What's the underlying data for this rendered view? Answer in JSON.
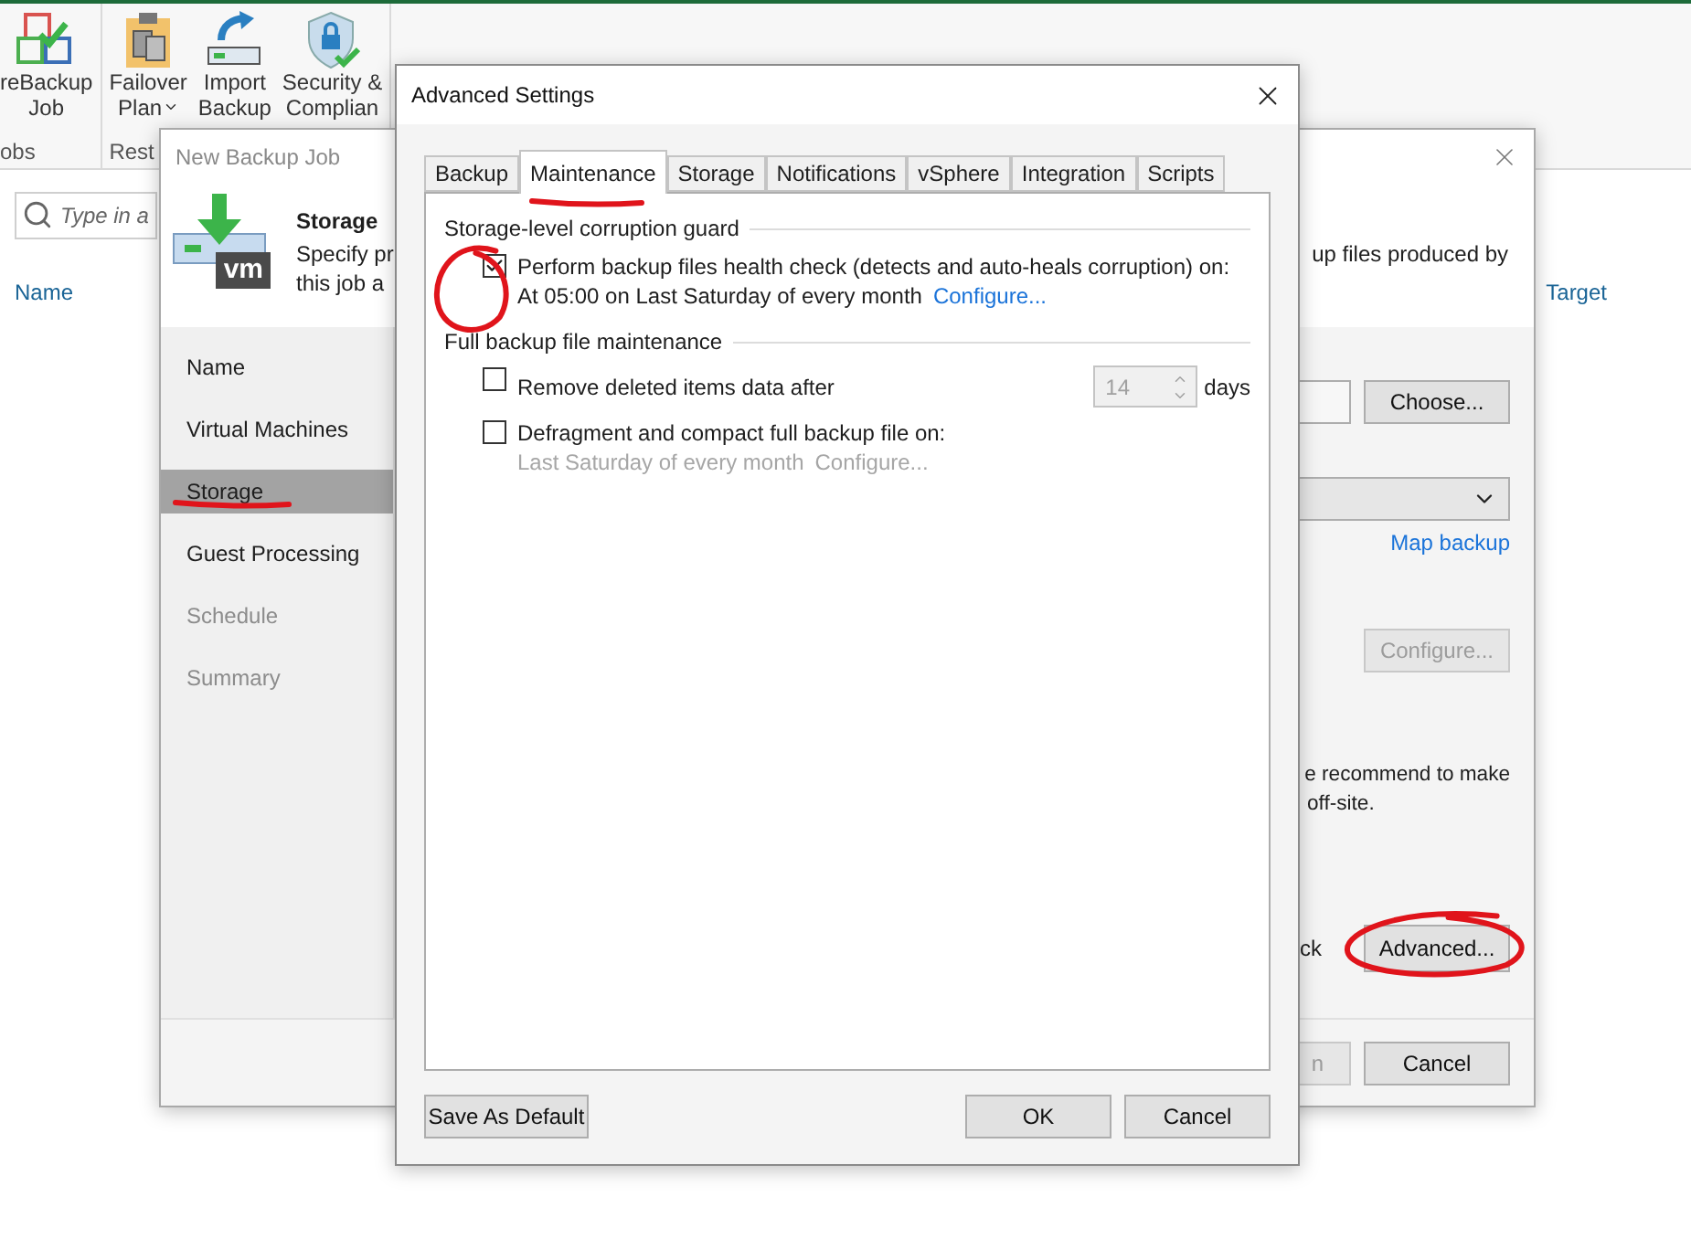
{
  "app": {
    "ribbon": {
      "groups": [
        {
          "label": "obs",
          "buttons": [
            {
              "kind": "backup-job",
              "lines": [
                "reBackup",
                "Job"
              ],
              "dropdown": false
            }
          ]
        },
        {
          "label": "Rest",
          "buttons": [
            {
              "kind": "failover",
              "lines": [
                "Failover",
                "Plan"
              ],
              "dropdown": true
            },
            {
              "kind": "import",
              "lines": [
                "Import",
                "Backup"
              ],
              "dropdown": false
            },
            {
              "kind": "security",
              "lines": [
                "Security &",
                "Complian"
              ],
              "dropdown": false
            }
          ]
        }
      ]
    },
    "search": {
      "placeholder": "Type in a"
    },
    "columns": [
      "Name",
      "Target"
    ]
  },
  "backup_job": {
    "title": "New Backup Job",
    "icon_badge": "vm",
    "step_title": "Storage",
    "description_lines": [
      "Specify pr",
      "this job a"
    ],
    "description_tail": "up files produced by",
    "steps": [
      {
        "label": "Name",
        "selected": false,
        "disabled": false,
        "underlined": false
      },
      {
        "label": "Virtual Machines",
        "selected": false,
        "disabled": false,
        "underlined": false
      },
      {
        "label": "Storage",
        "selected": true,
        "disabled": false,
        "underlined": true
      },
      {
        "label": "Guest Processing",
        "selected": false,
        "disabled": false,
        "underlined": false
      },
      {
        "label": "Schedule",
        "selected": false,
        "disabled": true,
        "underlined": false
      },
      {
        "label": "Summary",
        "selected": false,
        "disabled": true,
        "underlined": false
      }
    ],
    "choose_button": "Choose...",
    "map_link": "Map backup",
    "configure_button": {
      "label": "Configure...",
      "disabled": true
    },
    "note_lines": [
      "e recommend to make",
      "off-site."
    ],
    "advanced_tail": "ck",
    "advanced_button": {
      "label": "Advanced...",
      "circled": true
    },
    "finish_button": {
      "label": "n",
      "disabled": true
    },
    "cancel_button": "Cancel"
  },
  "advanced_settings": {
    "title": "Advanced Settings",
    "tabs": [
      {
        "label": "Backup",
        "selected": false,
        "underlined": false
      },
      {
        "label": "Maintenance",
        "selected": true,
        "underlined": true
      },
      {
        "label": "Storage",
        "selected": false,
        "underlined": false
      },
      {
        "label": "Notifications",
        "selected": false,
        "underlined": false
      },
      {
        "label": "vSphere",
        "selected": false,
        "underlined": false
      },
      {
        "label": "Integration",
        "selected": false,
        "underlined": false
      },
      {
        "label": "Scripts",
        "selected": false,
        "underlined": false
      }
    ],
    "sections": [
      {
        "title": "Storage-level corruption guard",
        "options": [
          {
            "label": "Perform backup files health check (detects and auto-heals corruption) on:",
            "checked": true,
            "circled": true,
            "detail": "At 05:00 on Last Saturday of every month",
            "link": "Configure...",
            "detail_disabled": false
          }
        ]
      },
      {
        "title": "Full backup file maintenance",
        "options": [
          {
            "label": "Remove deleted items data after",
            "checked": false,
            "circled": false,
            "spin": {
              "value": "14",
              "unit": "days",
              "disabled": true
            }
          },
          {
            "label": "Defragment and compact full backup file on:",
            "checked": false,
            "circled": false,
            "detail": "Last Saturday of every month",
            "link": "Configure...",
            "detail_disabled": true
          }
        ]
      }
    ],
    "save_default_button": "Save As Default",
    "ok_button": "OK",
    "cancel_button": "Cancel"
  }
}
